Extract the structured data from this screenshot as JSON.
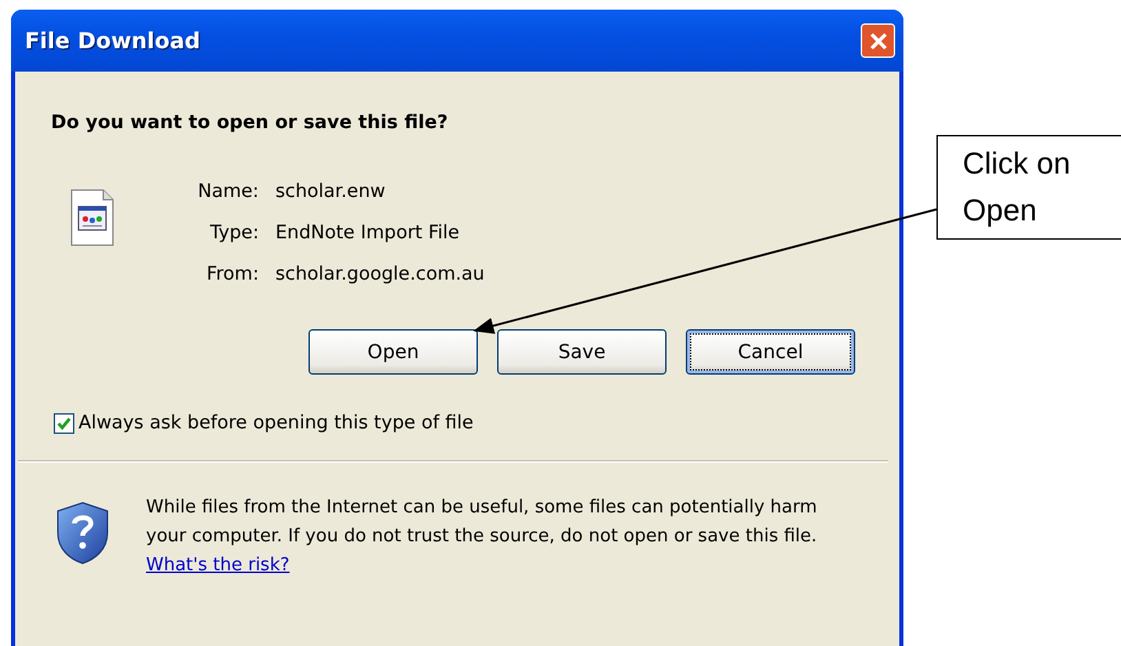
{
  "window": {
    "title": "File Download"
  },
  "question": "Do you want to open or save this file?",
  "file_info": [
    {
      "label": "Name:",
      "value": "scholar.enw"
    },
    {
      "label": "Type:",
      "value": "EndNote Import File"
    },
    {
      "label": "From:",
      "value": "scholar.google.com.au"
    }
  ],
  "buttons": [
    {
      "label": "Open",
      "default": false
    },
    {
      "label": "Save",
      "default": false
    },
    {
      "label": "Cancel",
      "default": true
    }
  ],
  "checkbox": {
    "label": "Always ask before opening this type of file",
    "checked": true
  },
  "warning": {
    "text": "While files from the Internet can be useful, some files can potentially harm your computer. If you do not trust the source, do not open or save this file.",
    "link": "What's the risk?"
  },
  "callout": {
    "text": "Click on Open"
  }
}
